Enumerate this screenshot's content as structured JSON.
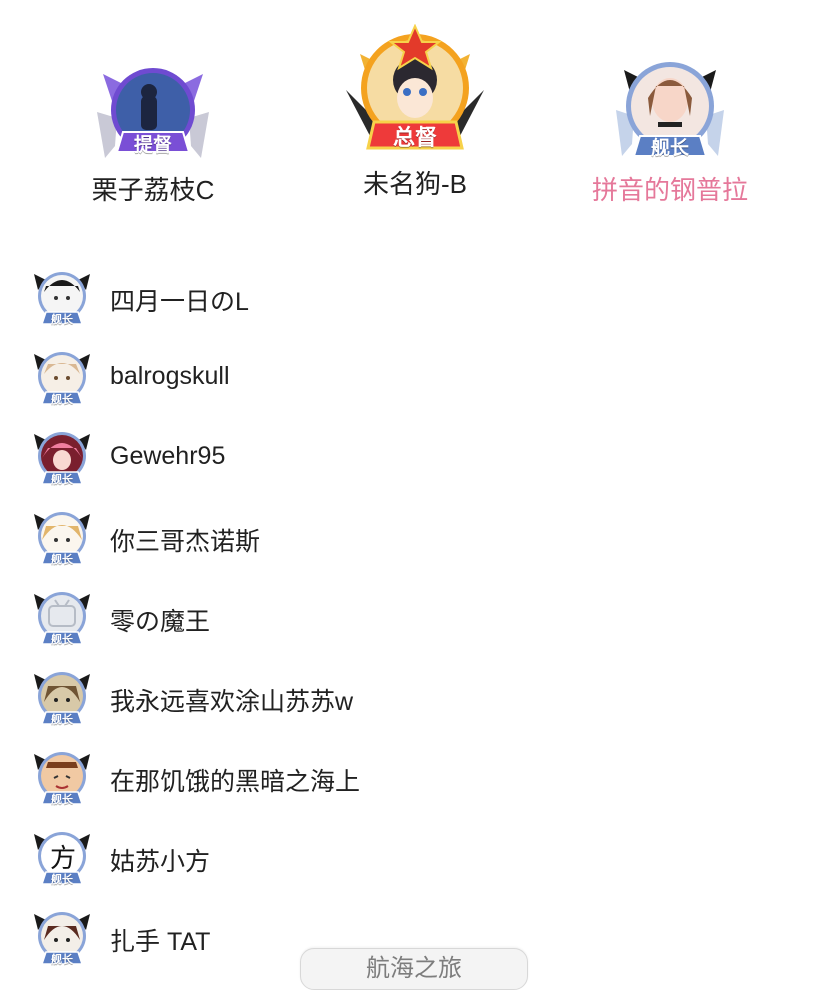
{
  "colors": {
    "highlight_name": "#e5789a",
    "admiral_badge": "#7a4fd6",
    "governor_badge": "#ee3a3a",
    "captain_badge": "#5b7fc4"
  },
  "top_users": [
    {
      "name": "栗子荔枝C",
      "badge": "提督"
    },
    {
      "name": "未名狗-B",
      "badge": "总督"
    },
    {
      "name": "拼音的钢普拉",
      "badge": "舰长"
    }
  ],
  "list": [
    {
      "name": "四月一日のL",
      "badge": "舰长",
      "avatar": "face-icon"
    },
    {
      "name": "balrogskull",
      "badge": "舰长",
      "avatar": "face-icon"
    },
    {
      "name": "Gewehr95",
      "badge": "舰长",
      "avatar": "face-icon"
    },
    {
      "name": "你三哥杰诺斯",
      "badge": "舰长",
      "avatar": "face-icon"
    },
    {
      "name": "零の魔王",
      "badge": "舰长",
      "avatar": "tv-icon"
    },
    {
      "name": "我永远喜欢涂山苏苏w",
      "badge": "舰长",
      "avatar": "face-icon"
    },
    {
      "name": "在那饥饿的黑暗之海上",
      "badge": "舰长",
      "avatar": "face-icon"
    },
    {
      "name": "姑苏小方",
      "badge": "舰长",
      "avatar": "text-avatar",
      "avatar_text": "方"
    },
    {
      "name": "扎手 TAT",
      "badge": "舰长",
      "avatar": "face-icon"
    }
  ],
  "bottom_tab": {
    "label": "航海之旅"
  }
}
